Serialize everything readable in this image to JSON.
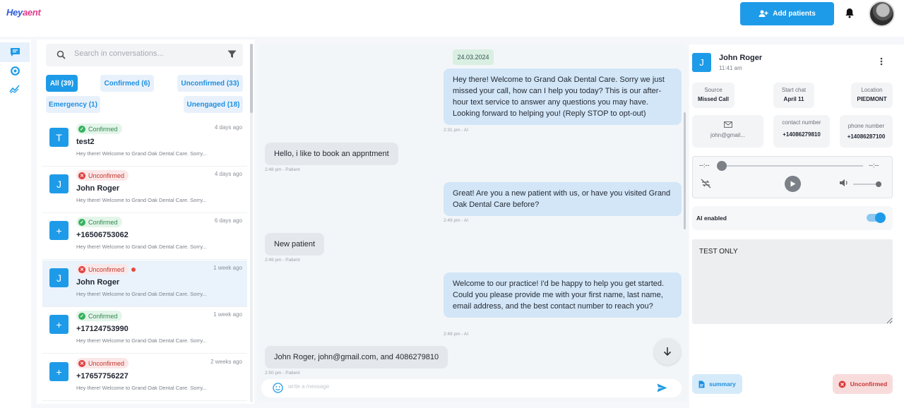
{
  "brand": {
    "logo_main": "Hey",
    "logo_accent": "aent"
  },
  "header": {
    "add_patients_label": "Add patients"
  },
  "sidebar": {
    "items": [
      {
        "name": "chat-icon"
      },
      {
        "name": "settings-icon"
      },
      {
        "name": "analytics-icon"
      }
    ]
  },
  "conversations": {
    "search_placeholder": "Search in conversations...",
    "filters": [
      {
        "label": "All (39)",
        "active": true
      },
      {
        "label": "Confirmed (6)"
      },
      {
        "label": "Unconfirmed (33)"
      },
      {
        "label": "Emergency (1)"
      },
      {
        "label": "Unengaged (18)"
      }
    ],
    "items": [
      {
        "initial": "T",
        "status": "Confirmed",
        "time": "4 days ago",
        "name": "test2",
        "preview": "Hey there! Welcome to Grand Oak Dental Care. Sorry..."
      },
      {
        "initial": "J",
        "status": "Unconfirmed",
        "time": "4 days ago",
        "name": "John Roger",
        "preview": "Hey there! Welcome to Grand Oak Dental Care. Sorry..."
      },
      {
        "initial": "+",
        "status": "Confirmed",
        "time": "6 days ago",
        "name": "+16506753062",
        "preview": "Hey there! Welcome to Grand Oak Dental Care. Sorry..."
      },
      {
        "initial": "J",
        "status": "Unconfirmed",
        "time": "1 week ago",
        "name": "John Roger",
        "preview": "Hey there! Welcome to Grand Oak Dental Care. Sorry..."
      },
      {
        "initial": "+",
        "status": "Confirmed",
        "time": "1 week ago",
        "name": "+17124753990",
        "preview": "Hey there! Welcome to Grand Oak Dental Care. Sorry..."
      },
      {
        "initial": "+",
        "status": "Unconfirmed",
        "time": "2 weeks ago",
        "name": "+17657756227",
        "preview": "Hey there! Welcome to Grand Oak Dental Care. Sorry..."
      }
    ]
  },
  "chat": {
    "date": "24.03.2024",
    "messages": [
      {
        "text": "Hey there! Welcome to Grand Oak Dental Care. Sorry we just missed your call, how can I help you today? This is our after-hour text service to answer any questions you may have. Looking forward to helping you! (Reply STOP to opt-out)",
        "meta": "2:31 pm - AI"
      },
      {
        "text": "Hello, i like to book an appntment",
        "meta": "2:48 pm - Patient"
      },
      {
        "text": "Great! Are you a new patient with us, or have you visited Grand Oak Dental Care before?",
        "meta": "2:49 pm - AI"
      },
      {
        "text": "New patient",
        "meta": "2:49 pm - Patient"
      },
      {
        "text": "Welcome to our practice! I'd be happy to help you get started. Could you please provide me with your first name, last name, email address, and the best contact number to reach you?",
        "meta": "2:49 pm - AI"
      },
      {
        "text": "John Roger, john@gmail.com, and 4086279810",
        "meta": "2:50 pm - Patient"
      }
    ],
    "composer_placeholder": "write a message"
  },
  "detail": {
    "initial": "J",
    "name": "John Roger",
    "time": "11:41 am",
    "source_label": "Source",
    "source_value": "Missed Call",
    "start_label": "Start chat",
    "start_value": "April 11",
    "location_label": "Location",
    "location_value": "PIEDMONT",
    "email": "john@gmail...",
    "contact_label": "contact number",
    "contact_value": "+14086279810",
    "phone_label": "phone number",
    "phone_value": "+14086287100",
    "player_time_left": "--:--",
    "player_time_right": "--:--",
    "ai_label": "AI enabled",
    "ai_enabled": true,
    "notes": "TEST ONLY",
    "summary_label": "summary",
    "status_label": "Unconfirmed"
  },
  "colors": {
    "accent": "#1e9be8",
    "confirmed": "#36b25e",
    "unconfirmed": "#e04040"
  }
}
